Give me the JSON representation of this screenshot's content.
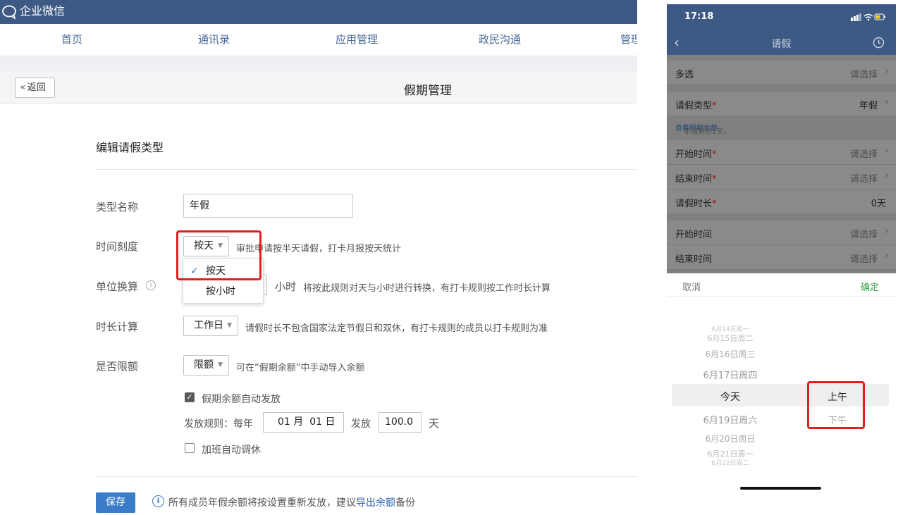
{
  "desktop": {
    "brand": "企业微信",
    "nav": [
      "首页",
      "通讯录",
      "应用管理",
      "政民沟通",
      "管理"
    ],
    "back_label": "返回",
    "page_title": "假期管理",
    "section_title": "编辑请假类型",
    "fields": {
      "type_name_label": "类型名称",
      "type_name_value": "年假",
      "time_scale_label": "时间刻度",
      "time_scale_value": "按天",
      "time_scale_hint": "审批申请按半天请假，打卡月报按天统计",
      "time_scale_options": [
        "按天",
        "按小时"
      ],
      "unit_label": "单位换算",
      "unit_suffix": "小时",
      "unit_hint": "将按此规则对天与小时进行转换，有打卡规则按工作时长计算",
      "duration_label": "时长计算",
      "duration_value": "工作日",
      "duration_hint": "请假时长不包含国家法定节假日和双休，有打卡规则的成员以打卡规则为准",
      "limit_label": "是否限额",
      "limit_value": "限额",
      "limit_hint": "可在“假期余额”中手动导入余额",
      "auto_issue_label": "假期余额自动发放",
      "auto_issue_checked": true,
      "rule_label": "发放规则：每年",
      "rule_month": "01",
      "rule_month_unit": "月",
      "rule_day": "01",
      "rule_day_unit": "日",
      "issue_label": "发放",
      "issue_amount": "100.0",
      "issue_unit": "天",
      "overtime_label": "加班自动调休",
      "overtime_checked": false
    },
    "save_label": "保存",
    "notice_prefix": "所有成员年假余额将按设置重新发放，建议",
    "notice_link": "导出余额",
    "notice_suffix": "备份"
  },
  "phone": {
    "time": "17:18",
    "title": "请假",
    "rows": [
      {
        "label": "多选",
        "value": "请选择"
      },
      {
        "label": "请假类型",
        "value": "年假"
      },
      {
        "label": "开始时间",
        "value": "请选择"
      },
      {
        "label": "结束时间",
        "value": "请选择"
      },
      {
        "label": "请假时长",
        "value": "0天"
      },
      {
        "label": "开始时间",
        "value": "请选择"
      },
      {
        "label": "结束时间",
        "value": "请选择"
      }
    ],
    "required_mark": "*",
    "balance_note": "年假剩余1天。",
    "balance_link": "查看假期余额",
    "picker_cancel": "取消",
    "picker_ok": "确定",
    "dates": [
      "6月14日周一",
      "6月15日周二",
      "6月16日周三",
      "6月17日周四",
      "今天",
      "6月19日周六",
      "6月20日周日",
      "6月21日周一",
      "6月22日周二"
    ],
    "ampm": [
      "上午",
      "下午"
    ]
  },
  "colors": {
    "header": "#3d5a84",
    "primary": "#3b7cc9",
    "highlight": "#e02020",
    "confirm": "#3aa452"
  }
}
